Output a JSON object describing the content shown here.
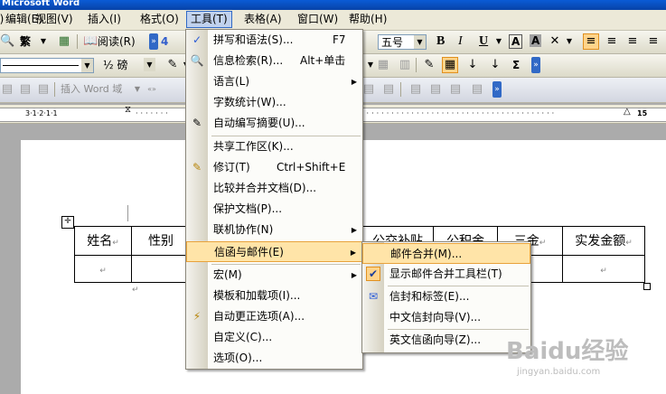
{
  "window": {
    "title": "Microsoft Word"
  },
  "menubar": {
    "items": [
      {
        "label": "件(F)"
      },
      {
        "label": "编辑(E)"
      },
      {
        "label": "视图(V)"
      },
      {
        "label": "插入(I)"
      },
      {
        "label": "格式(O)"
      },
      {
        "label": "工具(T)"
      },
      {
        "label": "表格(A)"
      },
      {
        "label": "窗口(W)"
      },
      {
        "label": "帮助(H)"
      }
    ]
  },
  "toolbar1": {
    "traditional": "繁",
    "reading": "阅读(R)",
    "num": "4",
    "font_size": "五号",
    "bold": "B",
    "italic": "I",
    "underline": "U",
    "char_a": "A",
    "char_a2": "A"
  },
  "toolbar2": {
    "line_weight": "½ 磅",
    "sigma": "Σ"
  },
  "toolbar3": {
    "insert_word_field": "插入 Word 域"
  },
  "ruler": {
    "left_mark": "3·1·2·1·1",
    "right_num": "15"
  },
  "table": {
    "headers": [
      "姓名",
      "性别",
      "公交补贴",
      "公积金",
      "三金",
      "实发金额"
    ],
    "row_mark": "↵"
  },
  "tools_menu": {
    "items": [
      {
        "label": "拼写和语法(S)...",
        "shortcut": "F7",
        "icon": "abc-check-icon"
      },
      {
        "label": "信息检索(R)...",
        "shortcut": "Alt+单击",
        "icon": "research-icon"
      },
      {
        "label": "语言(L)",
        "submenu": true
      },
      {
        "label": "字数统计(W)..."
      },
      {
        "label": "自动编写摘要(U)...",
        "icon": "summary-icon"
      },
      {
        "label": "共享工作区(K)..."
      },
      {
        "label": "修订(T)",
        "shortcut": "Ctrl+Shift+E",
        "icon": "track-changes-icon"
      },
      {
        "label": "比较并合并文档(D)..."
      },
      {
        "label": "保护文档(P)..."
      },
      {
        "label": "联机协作(N)",
        "submenu": true
      },
      {
        "label": "信函与邮件(E)",
        "submenu": true
      },
      {
        "label": "宏(M)",
        "submenu": true
      },
      {
        "label": "模板和加载项(I)..."
      },
      {
        "label": "自动更正选项(A)...",
        "icon": "autocorrect-icon"
      },
      {
        "label": "自定义(C)..."
      },
      {
        "label": "选项(O)..."
      }
    ]
  },
  "mail_submenu": {
    "items": [
      {
        "label": "邮件合并(M)..."
      },
      {
        "label": "显示邮件合并工具栏(T)",
        "checked": true
      },
      {
        "label": "信封和标签(E)...",
        "icon": "envelope-icon"
      },
      {
        "label": "中文信封向导(V)..."
      },
      {
        "label": "英文信函向导(Z)..."
      }
    ]
  },
  "watermark": {
    "brand": "Baidu经验",
    "url": "jingyan.baidu.com"
  }
}
